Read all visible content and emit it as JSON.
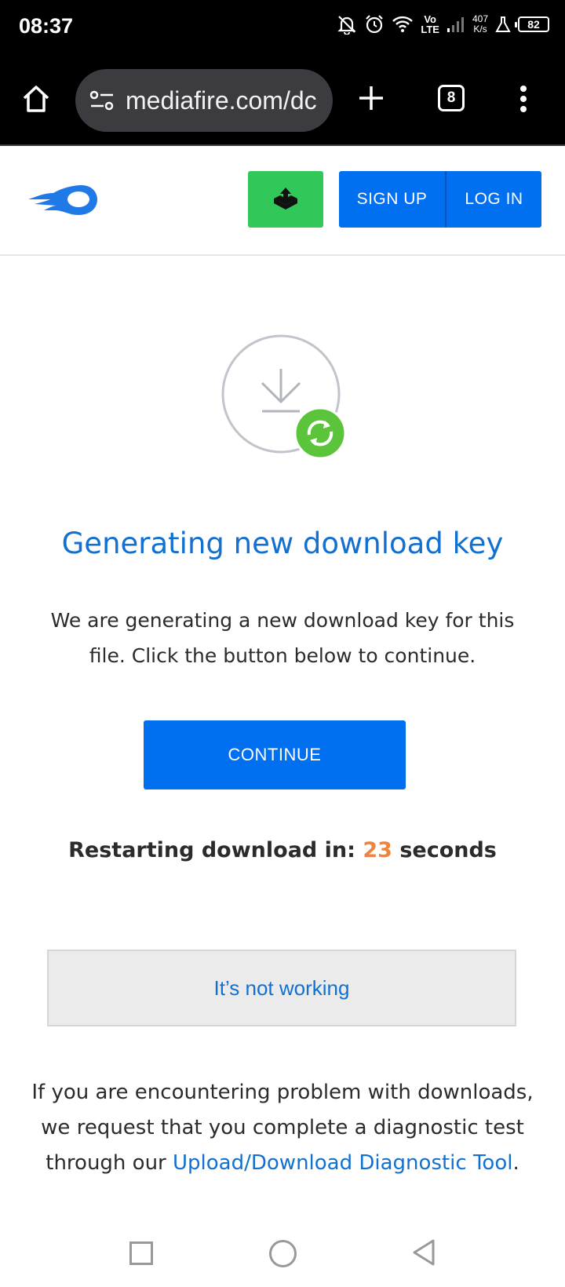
{
  "status_bar": {
    "time": "08:37",
    "volte_top": "Vo",
    "volte_bottom": "LTE",
    "speed_value": "407",
    "speed_unit": "K/s",
    "battery": "82",
    "icons": [
      "dnd-off-icon",
      "alarm-icon",
      "wifi-icon",
      "signal-icon",
      "lab-icon",
      "battery-icon"
    ]
  },
  "browser": {
    "url": "mediafire.com/dc",
    "tab_count": "8",
    "icons": [
      "home-icon",
      "site-settings-icon",
      "new-tab-icon",
      "tabs-icon",
      "more-icon"
    ]
  },
  "header": {
    "signup_label": "SIGN UP",
    "login_label": "LOG IN",
    "icons": [
      "mediafire-logo",
      "upload-icon"
    ]
  },
  "main": {
    "heading": "Generating new download key",
    "description": "We are generating a new download key for this file. Click the button below to continue.",
    "continue_label": "CONTINUE",
    "countdown_prefix": "Restarting download in:",
    "countdown_value": "23",
    "countdown_suffix": "seconds",
    "not_working_label": "It’s not working",
    "help_text": "If you are encountering problem with downloads, we request that you complete a diagnostic test through our",
    "help_link": "Upload/Download Diagnostic Tool",
    "help_end": ".",
    "icons": [
      "download-icon",
      "refresh-icon"
    ]
  },
  "colors": {
    "brand_blue": "#0070f0",
    "heading_blue": "#1270d0",
    "upload_green": "#32c759",
    "refresh_green": "#5cc43a",
    "countdown_orange": "#f0843c"
  }
}
